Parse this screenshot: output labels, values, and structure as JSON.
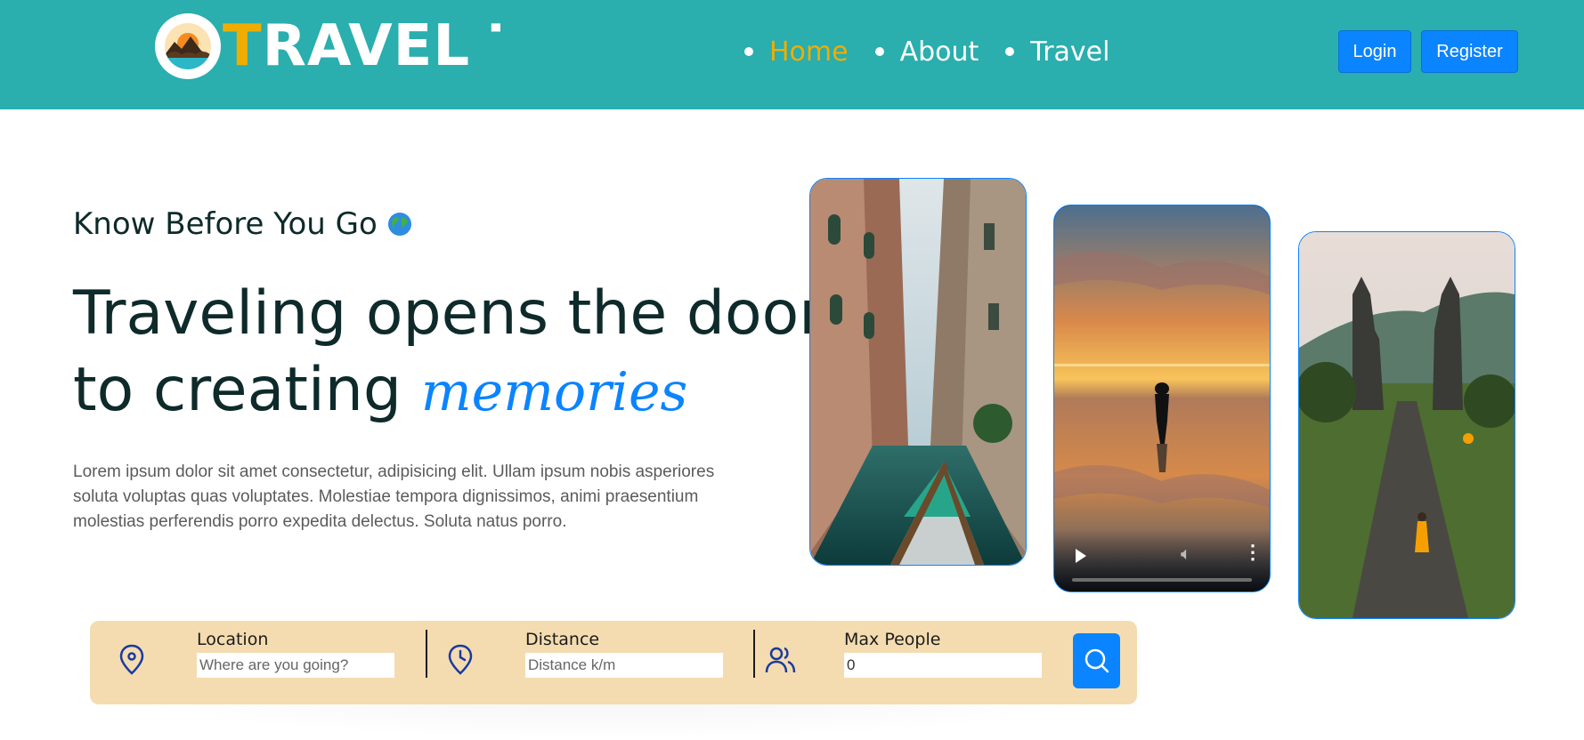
{
  "brand": {
    "logo_text_accent": "T",
    "logo_text_rest": "RAVEL T",
    "logo_icon": "island-sunset-icon",
    "accent_color": "#f0ad00",
    "header_color": "#2aaeae"
  },
  "nav": {
    "items": [
      {
        "label": "Home",
        "active": true
      },
      {
        "label": "About",
        "active": false
      },
      {
        "label": "Travel",
        "active": false
      }
    ]
  },
  "auth": {
    "login_label": "Login",
    "register_label": "Register",
    "button_color": "#0b84ff"
  },
  "hero": {
    "subtitle": "Know Before You Go",
    "subtitle_icon": "globe-icon",
    "headline_line1": "Traveling opens the door",
    "headline_line2_prefix": "to creating",
    "headline_accent": "memories",
    "description": "Lorem ipsum dolor sit amet consectetur, adipisicing elit. Ullam ipsum nobis asperiores soluta voluptas quas voluptates. Molestiae tempora dignissimos, animi praesentium molestias perferendis porro expedita delectus. Soluta natus porro."
  },
  "gallery": {
    "items": [
      {
        "type": "image",
        "subject": "venice-canal"
      },
      {
        "type": "video",
        "subject": "sunset-reflection"
      },
      {
        "type": "image",
        "subject": "temple-gate-path"
      }
    ]
  },
  "search": {
    "location": {
      "label": "Location",
      "placeholder": "Where are you going?",
      "icon": "map-pin-icon"
    },
    "distance": {
      "label": "Distance",
      "placeholder": "Distance k/m",
      "icon": "clock-icon"
    },
    "max_people": {
      "label": "Max People",
      "value": "0",
      "icon": "users-icon"
    },
    "button_icon": "search-icon",
    "bar_color": "#f4dcb0"
  }
}
